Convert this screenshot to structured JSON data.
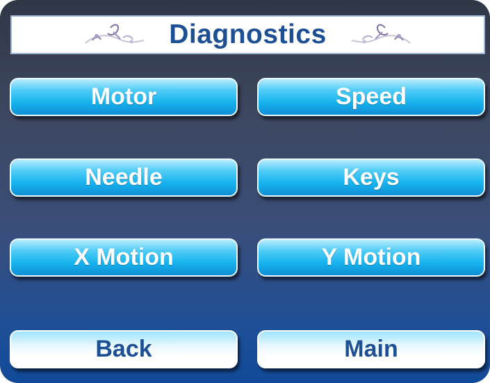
{
  "header": {
    "title": "Diagnostics",
    "left_ornament_icon": "floral-ornament-icon",
    "right_ornament_icon": "floral-ornament-icon"
  },
  "buttons": {
    "motor": "Motor",
    "speed": "Speed",
    "needle": "Needle",
    "keys": "Keys",
    "x_motion": "X Motion",
    "y_motion": "Y Motion",
    "back": "Back",
    "main": "Main"
  },
  "colors": {
    "title_text": "#1d4f95",
    "button_blue": "#17b3ee",
    "nav_text": "#1d4f95"
  }
}
